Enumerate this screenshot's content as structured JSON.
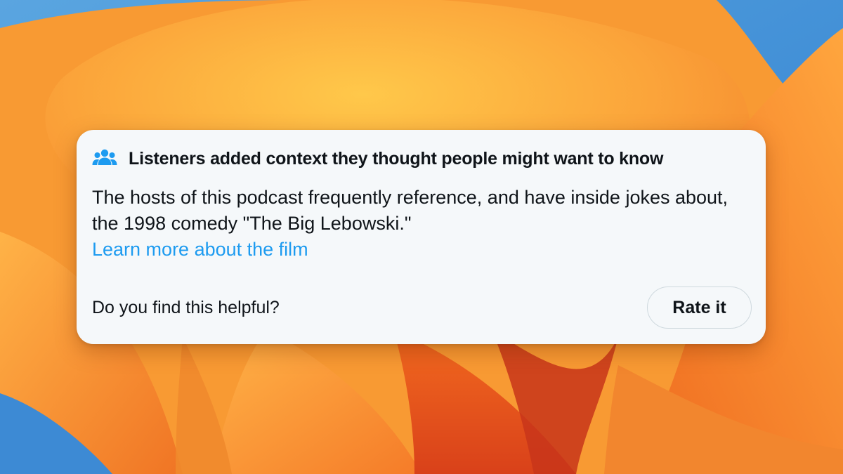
{
  "note": {
    "icon": "people-icon",
    "title": "Listeners added context they thought people might want to know",
    "body": "The hosts of this podcast frequently reference, and have inside jokes about, the 1998 comedy \"The Big Lebowski.\"",
    "link_text": "Learn more about the film",
    "helpful_question": "Do you find this helpful?",
    "rate_button_label": "Rate it"
  },
  "colors": {
    "link": "#1d9bf0",
    "icon": "#1d9bf0",
    "card_background": "#f5f8fa",
    "text": "#0f1419",
    "wallpaper_orange": "#f5a623",
    "wallpaper_blue": "#3c8fd6"
  }
}
